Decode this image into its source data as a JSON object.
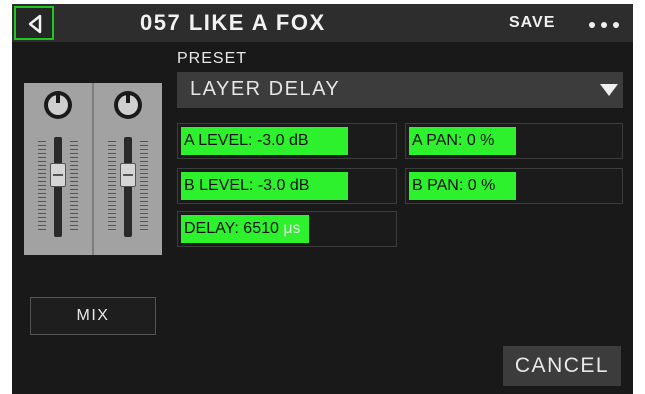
{
  "header": {
    "title": "057 LIKE A FOX",
    "save_label": "SAVE",
    "back_icon": "back-arrow-icon",
    "more_icon": "more-dots-icon"
  },
  "preset": {
    "label": "PRESET",
    "value": "LAYER DELAY"
  },
  "params": [
    {
      "name": "A LEVEL",
      "text_a": "A LEVEL: -3.0 dB",
      "text_b": ""
    },
    {
      "name": "A PAN",
      "text_a": "A PAN: 0 %",
      "text_b": ""
    },
    {
      "name": "B LEVEL",
      "text_a": "B LEVEL: -3.0 dB",
      "text_b": ""
    },
    {
      "name": "B PAN",
      "text_a": "B PAN: 0 %",
      "text_b": ""
    },
    {
      "name": "DELAY",
      "text_a": "DELAY: 6510 ",
      "text_b": "μs"
    }
  ],
  "mix_button": "MIX",
  "cancel_button": "CANCEL",
  "colors": {
    "accent_green": "#2ef12e",
    "back_border": "#22c322",
    "screen_bg": "#191919",
    "bar_bg": "#2d2d2d"
  }
}
